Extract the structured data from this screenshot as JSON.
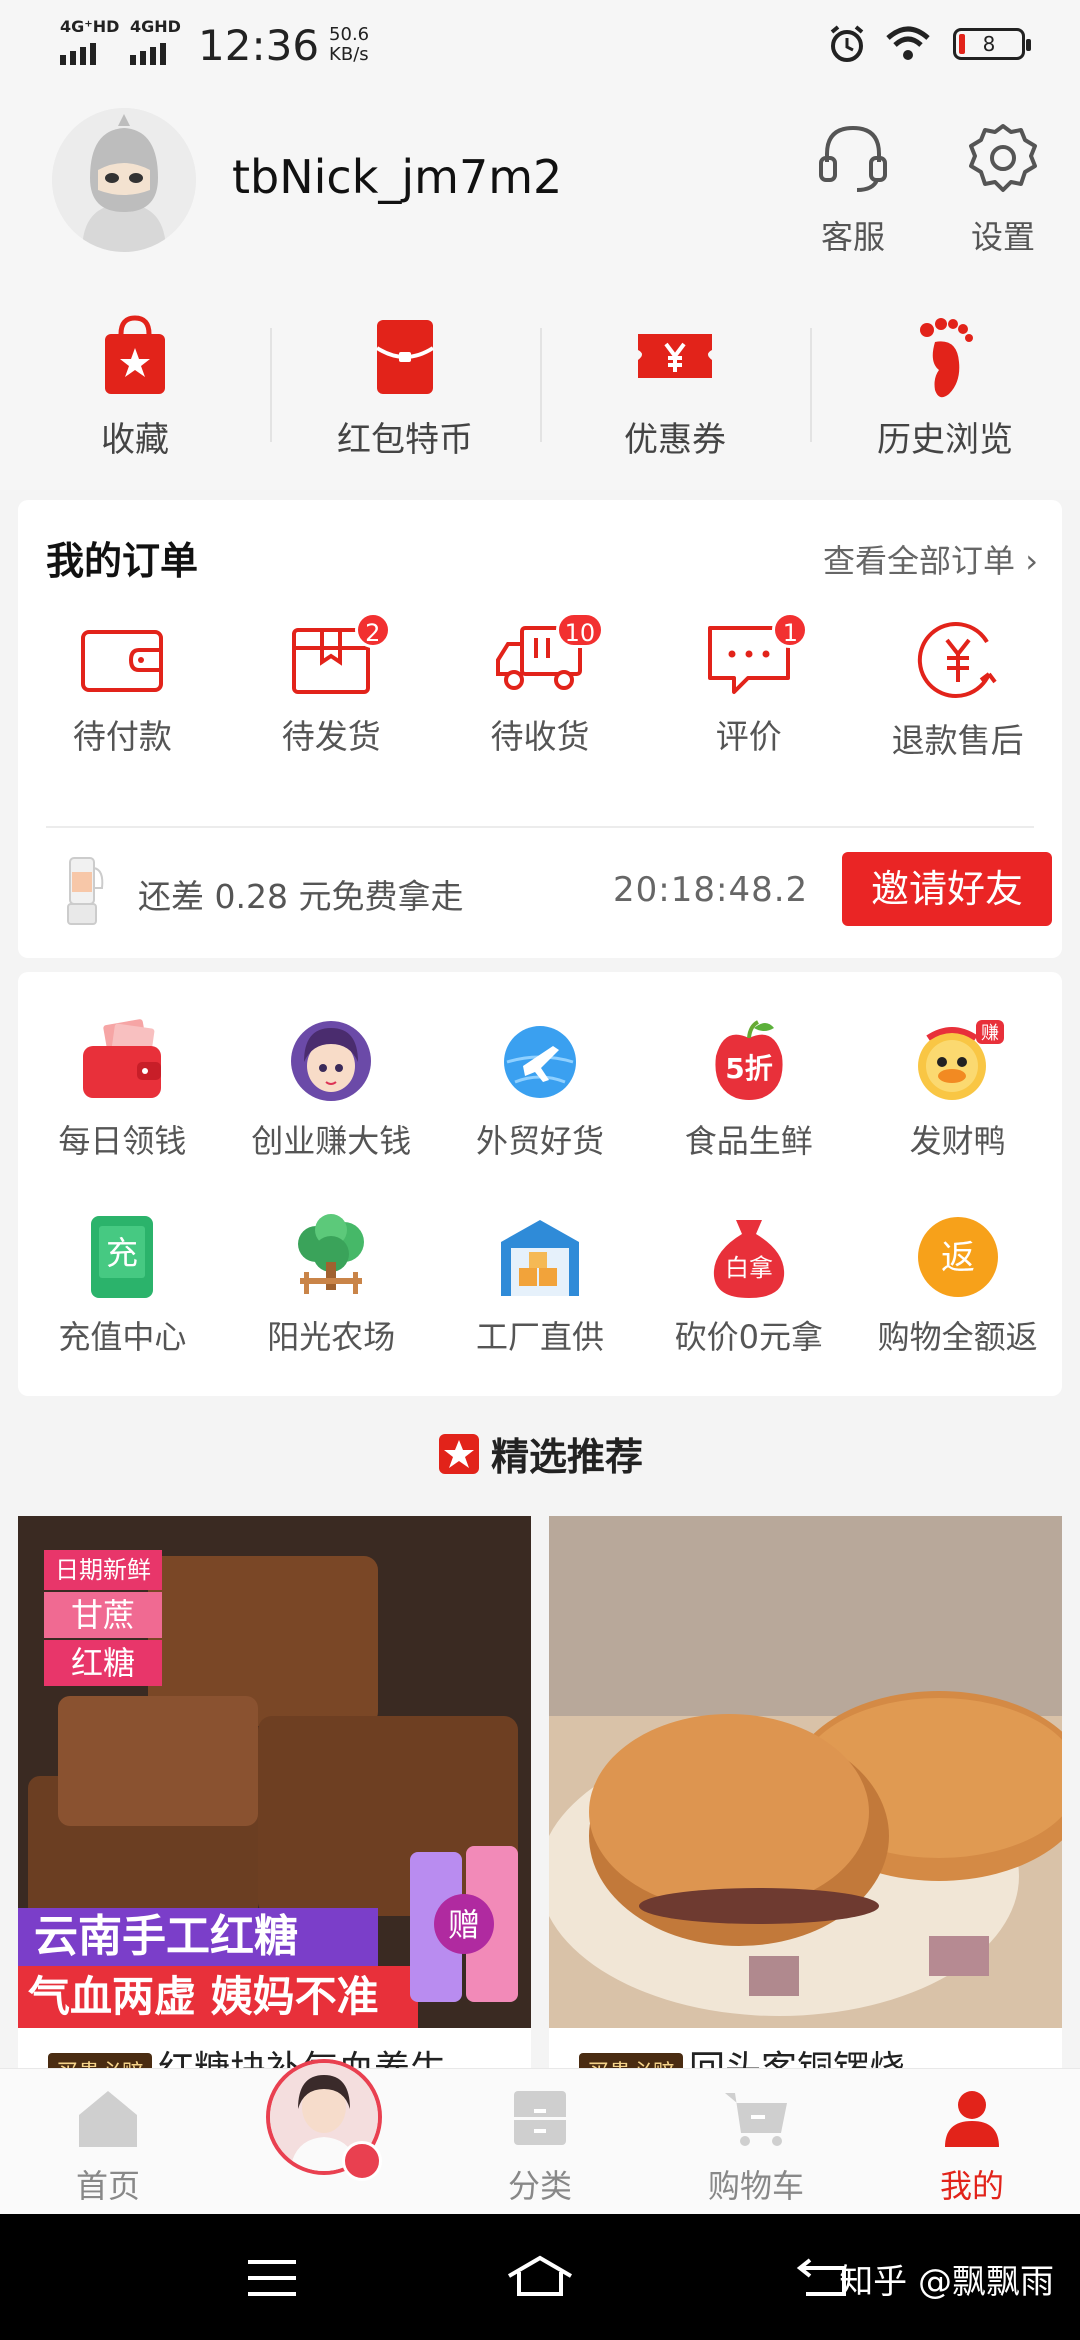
{
  "status_bar": {
    "signal1": "4G⁺HD",
    "signal2": "4GHD",
    "time": "12:36",
    "speed_value": "50.6",
    "speed_unit": "KB/s",
    "battery": "8"
  },
  "profile": {
    "username": "tbNick_jm7m2",
    "service_label": "客服",
    "settings_label": "设置"
  },
  "quick_links": [
    {
      "label": "收藏",
      "icon": "favorites-bag-icon"
    },
    {
      "label": "红包特币",
      "icon": "red-envelope-icon"
    },
    {
      "label": "优惠券",
      "icon": "coupon-icon"
    },
    {
      "label": "历史浏览",
      "icon": "footprint-icon"
    }
  ],
  "orders": {
    "title": "我的订单",
    "view_all": "查看全部订单 ›",
    "items": [
      {
        "label": "待付款",
        "icon": "wallet-icon",
        "badge": ""
      },
      {
        "label": "待发货",
        "icon": "box-icon",
        "badge": "2"
      },
      {
        "label": "待收货",
        "icon": "truck-icon",
        "badge": "10"
      },
      {
        "label": "评价",
        "icon": "comment-icon",
        "badge": "1"
      },
      {
        "label": "退款售后",
        "icon": "refund-icon",
        "badge": ""
      }
    ],
    "promo_text": "还差 0.28 元免费拿走",
    "countdown": "20:18:48.2",
    "invite_button": "邀请好友"
  },
  "services": [
    {
      "label": "每日领钱",
      "icon": "wallet-money-icon"
    },
    {
      "label": "创业赚大钱",
      "icon": "girl-avatar-icon"
    },
    {
      "label": "外贸好货",
      "icon": "globe-plane-icon"
    },
    {
      "label": "食品生鲜",
      "icon": "apple-discount-icon"
    },
    {
      "label": "发财鸭",
      "icon": "duck-icon"
    },
    {
      "label": "充值中心",
      "icon": "recharge-icon"
    },
    {
      "label": "阳光农场",
      "icon": "tree-icon"
    },
    {
      "label": "工厂直供",
      "icon": "factory-icon"
    },
    {
      "label": "砍价0元拿",
      "icon": "money-bag-icon"
    },
    {
      "label": "购物全额返",
      "icon": "refund-circle-icon"
    }
  ],
  "service_badges": {
    "five_discount": "5折",
    "earn": "赚",
    "recharge": "充",
    "free_take": "白拿",
    "return": "返"
  },
  "recommend": {
    "title": "精选推荐",
    "products": [
      {
        "tag": "买贵必赔",
        "title": "红糖块补气血养生",
        "banner_top": "日期新鲜",
        "banner_mid": "甘蔗",
        "banner_bot": "红糖",
        "slogan1": "云南手工红糖",
        "slogan2": "气血两虚 姨妈不准",
        "gift": "赠"
      },
      {
        "tag": "买贵必赔",
        "title": "回头客铜锣烧"
      }
    ]
  },
  "tabbar": [
    {
      "label": "首页",
      "icon": "home-icon"
    },
    {
      "label": "",
      "icon": "live-avatar-icon"
    },
    {
      "label": "分类",
      "icon": "category-icon"
    },
    {
      "label": "购物车",
      "icon": "cart-icon"
    },
    {
      "label": "我的",
      "icon": "profile-icon"
    }
  ],
  "watermark": "知乎 @飘飘雨",
  "colors": {
    "accent": "#e2231a",
    "background": "#f4f4f4",
    "card": "#ffffff"
  }
}
